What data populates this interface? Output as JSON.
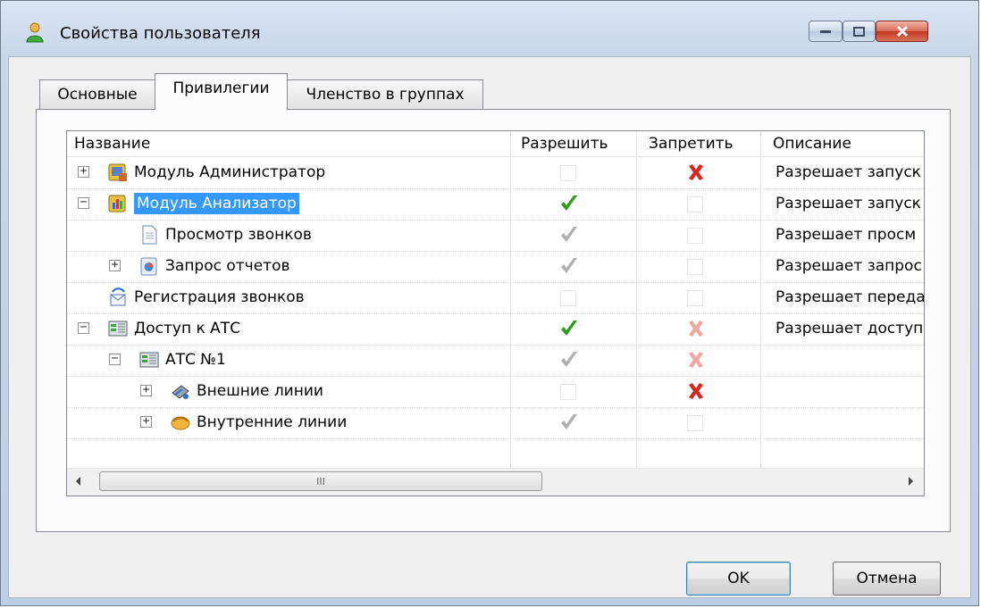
{
  "window": {
    "title": "Свойства пользователя"
  },
  "tabs": [
    {
      "label": "Основные"
    },
    {
      "label": "Привилегии"
    },
    {
      "label": "Членство в группах"
    }
  ],
  "active_tab": "Привилегии",
  "grid": {
    "columns": {
      "name": "Название",
      "allow": "Разрешить",
      "deny": "Запретить",
      "description": "Описание"
    },
    "rows": [
      {
        "name": "Модуль Администратор",
        "level": 0,
        "expander": "+",
        "icon": "admin-module-icon",
        "allow": "none",
        "deny": "deny",
        "description": "Разрешает запуск"
      },
      {
        "name": "Модуль Анализатор",
        "level": 0,
        "expander": "−",
        "icon": "analyzer-module-icon",
        "allow": "allow",
        "deny": "none",
        "description": "Разрешает запуск",
        "selected": true
      },
      {
        "name": "Просмотр звонков",
        "level": 1,
        "expander": "",
        "icon": "document-icon",
        "allow": "allow-inherited",
        "deny": "none",
        "description": "Разрешает просм"
      },
      {
        "name": "Запрос отчетов",
        "level": 1,
        "expander": "+",
        "icon": "report-icon",
        "allow": "allow-inherited",
        "deny": "none",
        "description": "Разрешает запрос"
      },
      {
        "name": "Регистрация звонков",
        "level": 0,
        "expander": "",
        "icon": "call-registration-icon",
        "allow": "none",
        "deny": "none",
        "description": "Разрешает переда"
      },
      {
        "name": "Доступ к АТС",
        "level": 0,
        "expander": "−",
        "icon": "pbx-icon",
        "allow": "allow",
        "deny": "deny-inherited",
        "description": "Разрешает доступ"
      },
      {
        "name": "АТС №1",
        "level": 1,
        "expander": "−",
        "icon": "pbx-icon",
        "allow": "allow-inherited",
        "deny": "deny-inherited",
        "description": ""
      },
      {
        "name": "Внешние линии",
        "level": 2,
        "expander": "+",
        "icon": "external-lines-icon",
        "allow": "none",
        "deny": "deny",
        "description": ""
      },
      {
        "name": "Внутренние линии",
        "level": 2,
        "expander": "+",
        "icon": "internal-lines-icon",
        "allow": "allow-inherited",
        "deny": "none",
        "description": ""
      }
    ]
  },
  "scrollbar": {
    "thumb_grip": "III"
  },
  "buttons": {
    "ok": "OK",
    "cancel": "Отмена"
  },
  "colors": {
    "selection": "#3399ff",
    "allow": "#2e9e1a",
    "deny": "#d9261c"
  }
}
